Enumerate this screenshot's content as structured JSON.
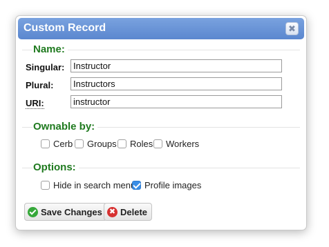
{
  "dialog": {
    "title": "Custom Record",
    "close_glyph": "✖"
  },
  "name_section": {
    "heading": "Name:",
    "singular_label": "Singular:",
    "singular_value": "Instructor",
    "plural_label": "Plural:",
    "plural_value": "Instructors",
    "uri_label": "URI:",
    "uri_value": "instructor"
  },
  "ownable_section": {
    "heading": "Ownable by:",
    "options": [
      {
        "label": "Cerb",
        "checked": false
      },
      {
        "label": "Groups",
        "checked": false
      },
      {
        "label": "Roles",
        "checked": false
      },
      {
        "label": "Workers",
        "checked": false
      }
    ]
  },
  "options_section": {
    "heading": "Options:",
    "options": [
      {
        "label": "Hide in search menu",
        "checked": false
      },
      {
        "label": "Profile images",
        "checked": true
      }
    ]
  },
  "buttons": {
    "save_label": "Save Changes",
    "delete_label": "Delete",
    "delete_glyph": "✖"
  },
  "colors": {
    "titlebar": "#6793d6",
    "section_heading": "#1f7a1f",
    "checkbox_checked": "#3a8ee6",
    "save_icon": "#36a83a",
    "delete_icon": "#d73131"
  }
}
